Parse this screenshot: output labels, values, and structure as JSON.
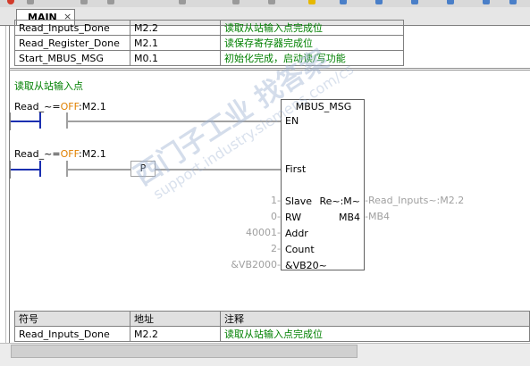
{
  "tab": {
    "label": "MAIN",
    "close": "×"
  },
  "top_table": {
    "rows": [
      [
        "Read_Inputs_Done",
        "M2.2",
        "读取从站输入点完成位"
      ],
      [
        "Read_Register_Done",
        "M2.1",
        "读保存寄存器完成位"
      ],
      [
        "Start_MBUS_MSG",
        "M0.1",
        "初始化完成，启动读/写功能"
      ]
    ]
  },
  "network": {
    "title": "读取从站输入点",
    "contact1": {
      "name": "Read_~",
      "eq": "=",
      "state": "OFF",
      "addr": ":M2.1"
    },
    "contact2": {
      "name": "Read_~",
      "eq": "=",
      "state": "OFF",
      "addr": ":M2.1"
    },
    "p_label": "P",
    "block": {
      "title": "MBUS_MSG",
      "en": "EN",
      "first": "First",
      "slave_val": "1",
      "slave": "Slave",
      "rw_val": "0",
      "rw": "RW",
      "addr_val": "40001",
      "addr": "Addr",
      "count_val": "2",
      "count": "Count",
      "data_val": "&VB2000",
      "data": "&VB20~",
      "done": "Re~:M~",
      "done_val": "Read_Inputs~:M2.2",
      "error": "MB4",
      "error_val": "MB4"
    }
  },
  "bottom_table": {
    "headers": [
      "符号",
      "地址",
      "注释"
    ],
    "rows": [
      [
        "Read_Inputs_Done",
        "M2.2",
        "读取从站输入点完成位"
      ]
    ]
  },
  "watermark": {
    "line1": "西门子工业  找答案",
    "line2": "support.industry.siemens.com/cs"
  },
  "colors": {
    "contact": "#1a2fb0",
    "comment": "#008000",
    "off_state": "#e08000"
  }
}
